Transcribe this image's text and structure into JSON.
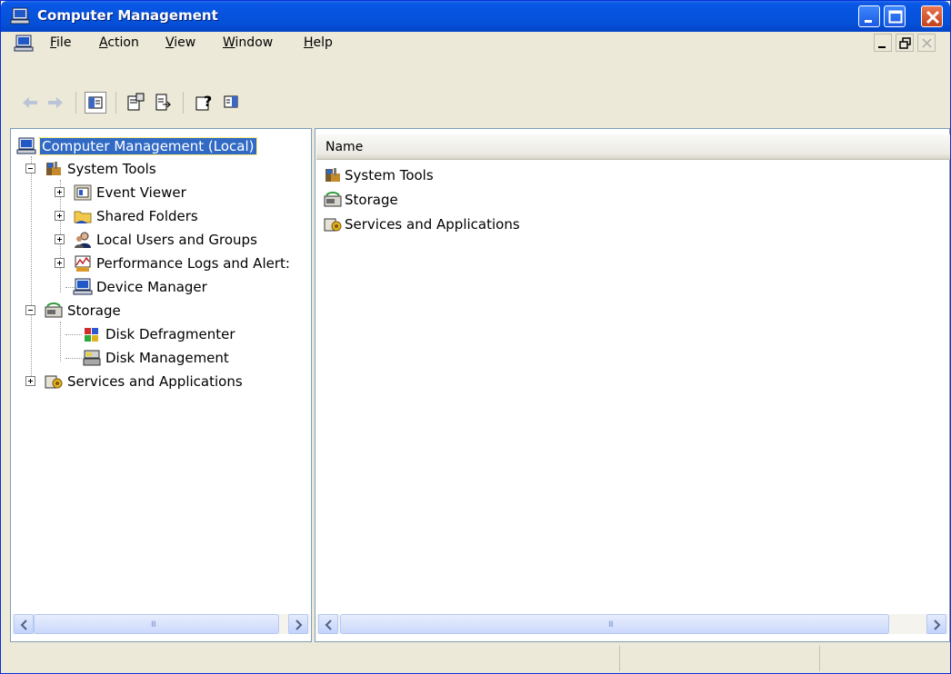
{
  "window": {
    "title": "Computer Management"
  },
  "menubar": {
    "items": [
      {
        "label": "File",
        "underline": "F",
        "rest": "ile"
      },
      {
        "label": "Action",
        "underline": "A",
        "rest": "ction"
      },
      {
        "label": "View",
        "underline": "V",
        "rest": "iew"
      },
      {
        "label": "Window",
        "underline": "W",
        "rest": "indow"
      },
      {
        "label": "Help",
        "underline": "H",
        "rest": "elp"
      }
    ]
  },
  "toolbar": {
    "buttons": [
      "back-icon",
      "forward-icon",
      "show-hide-console-tree-icon",
      "properties-icon",
      "export-list-icon",
      "help-icon",
      "show-hide-action-pane-icon"
    ]
  },
  "tree": {
    "root": "Computer Management (Local)",
    "system_tools": "System Tools",
    "event_viewer": "Event Viewer",
    "shared_folders": "Shared Folders",
    "local_users": "Local Users and Groups",
    "perf_logs": "Performance Logs and Alert:",
    "device_manager": "Device Manager",
    "storage": "Storage",
    "disk_defrag": "Disk Defragmenter",
    "disk_mgmt": "Disk Management",
    "services": "Services and Applications"
  },
  "list": {
    "column_name": "Name",
    "items": [
      "System Tools",
      "Storage",
      "Services and Applications"
    ]
  },
  "scrollbar": {
    "grip": "III"
  }
}
